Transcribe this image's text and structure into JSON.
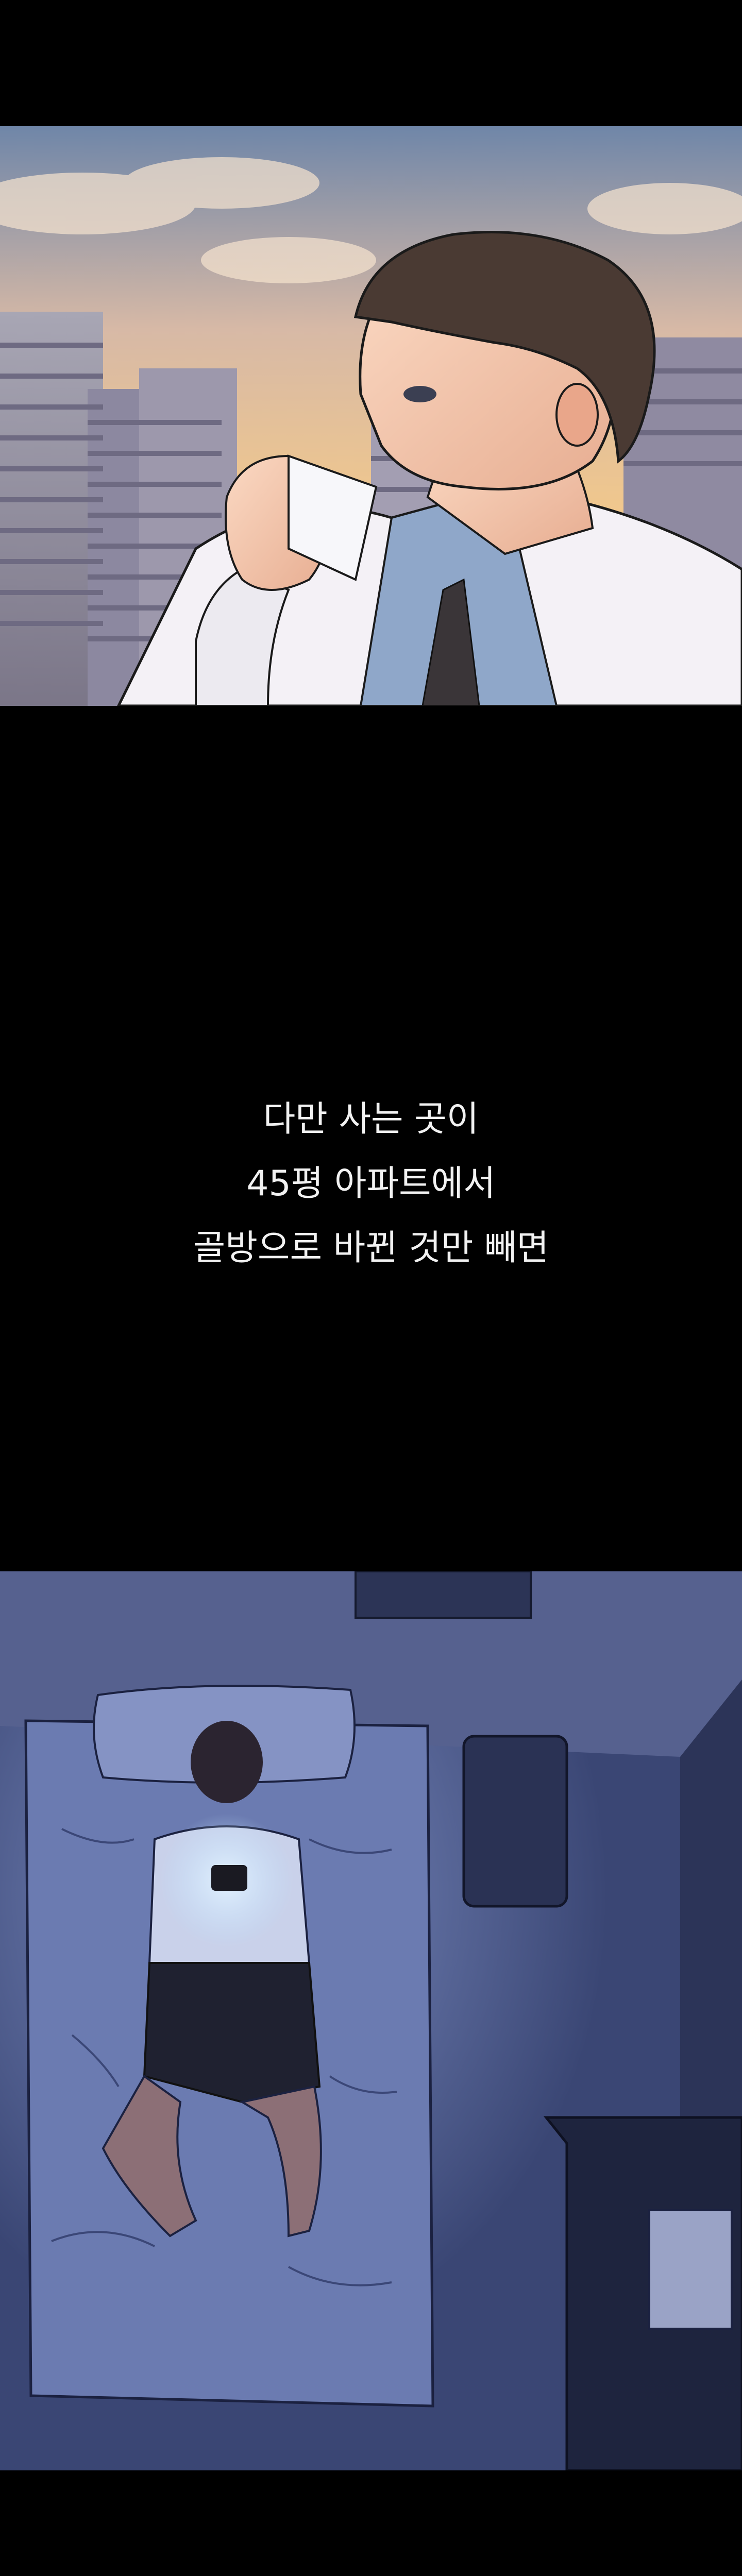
{
  "caption": {
    "lines": [
      "다만 사는 곳이",
      "45평 아파트에서",
      "골방으로 바뀐 것만 빼면"
    ]
  },
  "colors": {
    "background": "#000000",
    "sky_warm": "#f3c98a",
    "night_room": "#3c4a78",
    "phone_glow": "#bfe3ff"
  }
}
